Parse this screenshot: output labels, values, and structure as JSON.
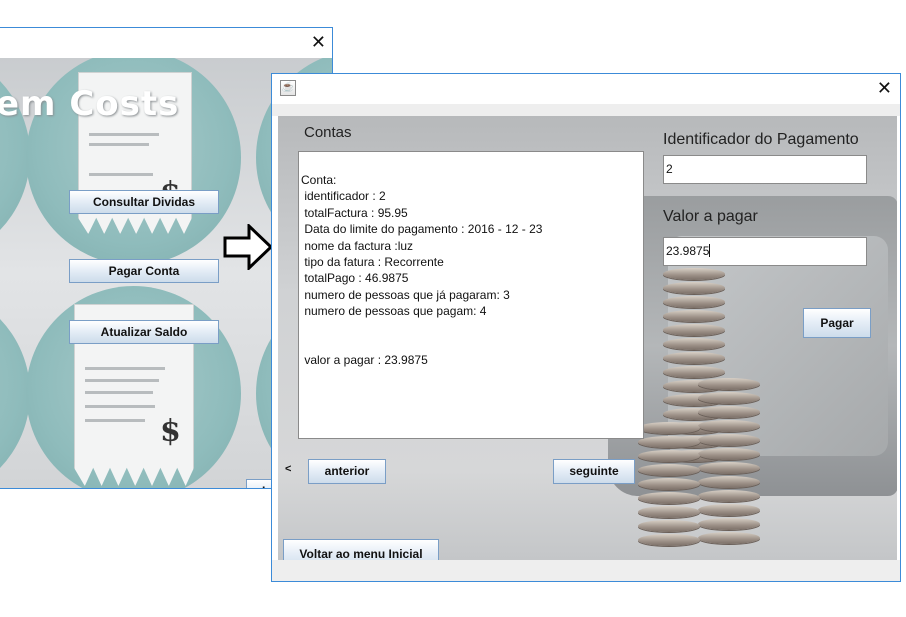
{
  "background_window": {
    "close_glyph": "✕",
    "title_text": "em Costs",
    "dollar_glyph": "$",
    "buttons": {
      "consultar": "Consultar Dividas",
      "pagar": "Pagar Conta",
      "atualizar": "Atualizar  Saldo",
      "partial": "Le"
    }
  },
  "front_window": {
    "close_glyph": "✕",
    "icon": "java-cup-icon",
    "contas_label": "Contas",
    "id_label": "Identificador do Pagamento",
    "id_value": "2",
    "valor_label": "Valor a pagar",
    "valor_value": "23.9875",
    "pagar_button": "Pagar",
    "anterior_button": "anterior",
    "seguinte_button": "seguinte",
    "prev_glyph": "<",
    "voltar_button": "Voltar ao menu Inicial",
    "details": [
      "Conta:",
      " identificador : 2",
      " totalFactura : 95.95",
      " Data do limite do pagamento : 2016 - 12 - 23",
      " nome da factura :luz",
      " tipo da fatura : Recorrente",
      " totalPago : 46.9875",
      " numero de pessoas que já pagaram: 3",
      " numero de pessoas que pagam: 4",
      "",
      "",
      " valor a pagar : 23.9875"
    ]
  },
  "colors": {
    "window_border": "#3c8bd8",
    "button_border": "#7a9ec6",
    "teal": "#8fbcbc"
  }
}
